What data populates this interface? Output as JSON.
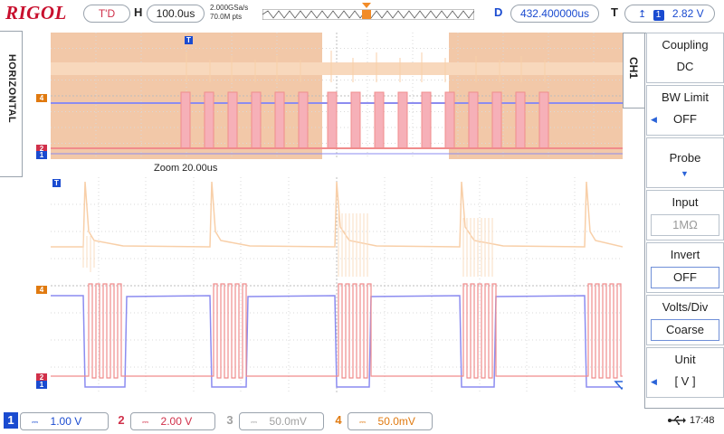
{
  "header": {
    "logo": "RIGOL",
    "run_status": "T'D",
    "horizontal_label": "H",
    "timebase": "100.0us",
    "sample_rate": "2.000GSa/s",
    "memory_points": "70.0M pts",
    "delay_label": "D",
    "delay_value": "432.400000us",
    "trigger_label": "T",
    "trigger_channel": "1",
    "trigger_level": "2.82 V"
  },
  "side_tab": {
    "label": "HORIZONTAL"
  },
  "zoom": {
    "label": "Zoom  20.00us"
  },
  "markers": {
    "ch1": "1",
    "ch2": "2",
    "ch4": "4",
    "trig": "T"
  },
  "menu": {
    "channel_tab": "CH1",
    "items": [
      {
        "title": "Coupling",
        "value": "DC"
      },
      {
        "title": "BW Limit",
        "value": "OFF"
      },
      {
        "title": "Probe",
        "value": ""
      },
      {
        "title": "Input",
        "value": "1MΩ"
      },
      {
        "title": "Invert",
        "value": "OFF"
      },
      {
        "title": "Volts/Div",
        "value": "Coarse"
      },
      {
        "title": "Unit",
        "value": "[  V  ]"
      }
    ]
  },
  "channels": [
    {
      "num": "1",
      "scale": "1.00 V",
      "color": "#1a4bd0"
    },
    {
      "num": "2",
      "scale": "2.00 V",
      "color": "#d0304a"
    },
    {
      "num": "3",
      "scale": "50.0mV",
      "color": "#a0a0a0"
    },
    {
      "num": "4",
      "scale": "50.0mV",
      "color": "#e07a10"
    }
  ],
  "status": {
    "clock": "17:48"
  },
  "colors": {
    "ch1": "#8c8cf0",
    "ch2": "#f08c8c",
    "ch4": "#f5c9a0",
    "overview_bg": "#f2c8a8"
  }
}
